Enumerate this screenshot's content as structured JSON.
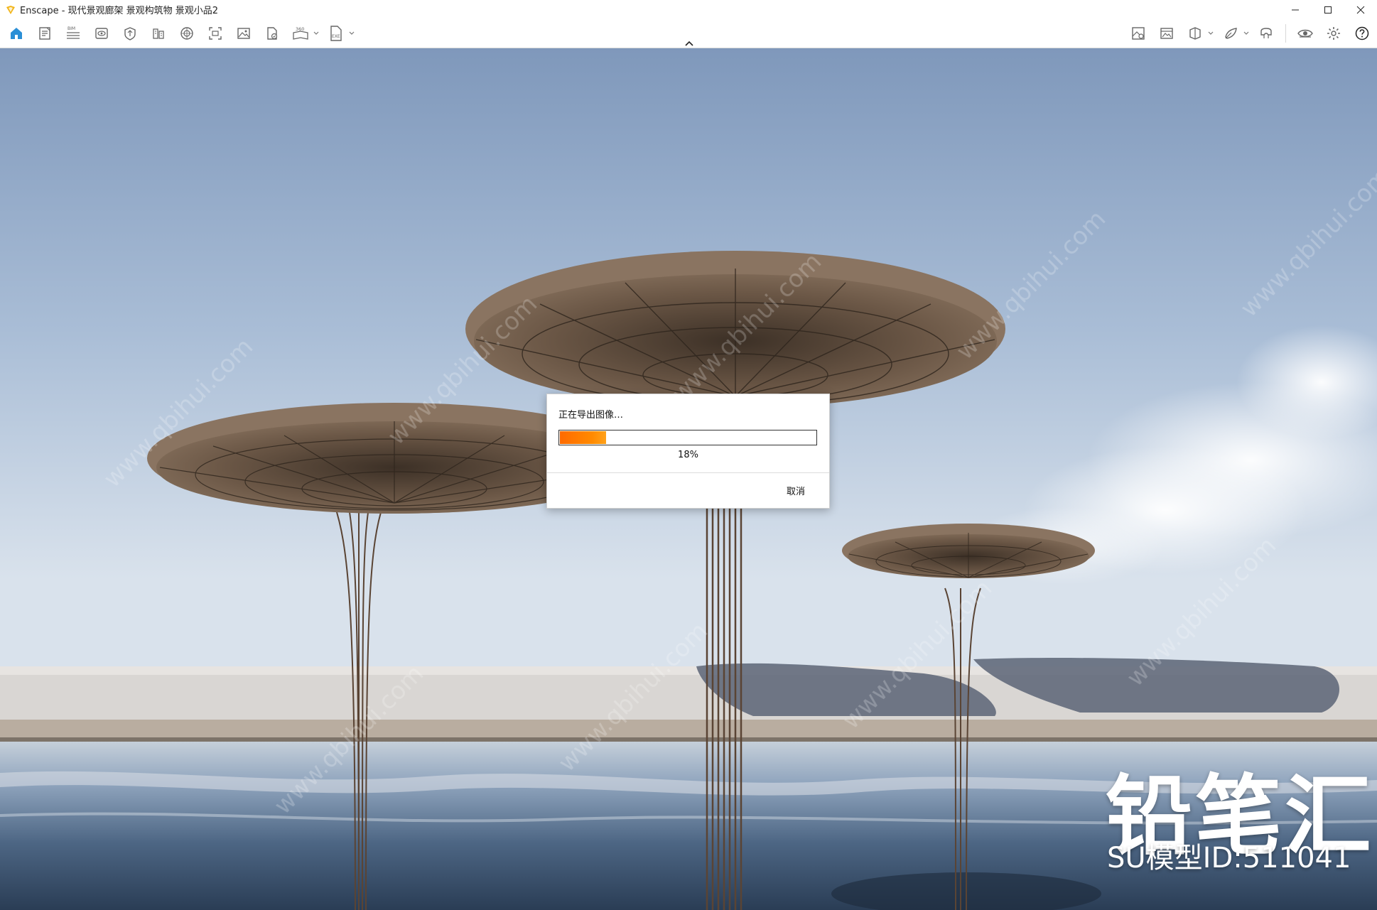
{
  "window": {
    "title": "Enscape - 现代景观廊架 景观构筑物 景观小品2",
    "controls": [
      "minimize-icon",
      "maximize-icon",
      "close-icon"
    ]
  },
  "toolbar": {
    "left_tools": [
      {
        "name": "home-icon",
        "active": true
      },
      {
        "name": "document-icon"
      },
      {
        "name": "bim-icon",
        "badge": "BIM"
      },
      {
        "name": "visual-settings-icon"
      },
      {
        "name": "asset-library-icon"
      },
      {
        "name": "sun-study-icon"
      },
      {
        "name": "material-editor-icon"
      },
      {
        "name": "screenshot-icon"
      },
      {
        "name": "image-export-icon"
      },
      {
        "name": "batch-export-icon"
      },
      {
        "name": "panorama-360-icon",
        "badge": "360",
        "dropdown": true
      },
      {
        "name": "exe-export-icon",
        "badge": "EXE",
        "dropdown": true
      }
    ],
    "right_tools": [
      {
        "name": "view-management-icon"
      },
      {
        "name": "image-gallery-icon"
      },
      {
        "name": "section-view-icon",
        "dropdown": true
      },
      {
        "name": "collaboration-icon",
        "dropdown": true
      },
      {
        "name": "vr-headset-icon"
      },
      {
        "name": "live-view-icon"
      },
      {
        "name": "settings-icon"
      },
      {
        "name": "help-icon"
      }
    ]
  },
  "dialog": {
    "title": "正在导出图像…",
    "progress": 0.18,
    "progress_label": "18%",
    "cancel_label": "取消"
  },
  "watermark": {
    "brand": "铅笔汇",
    "model_id": "SU模型ID:511041"
  },
  "colors": {
    "progress": "#ff7a00",
    "home_accent": "#2b8fd6",
    "logo": "#f2b519"
  }
}
